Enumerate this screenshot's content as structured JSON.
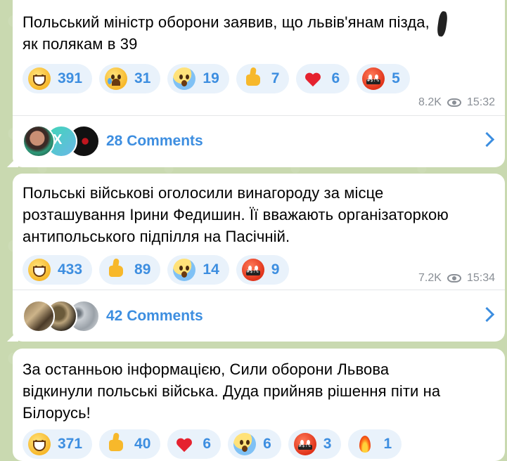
{
  "messages": [
    {
      "text": "Польський міністр оборони заявив, що львів'янам пізда,\nяк полякам в 39",
      "reactions": [
        {
          "emoji": "grinning-face",
          "count": "391"
        },
        {
          "emoji": "crying-face",
          "count": "31"
        },
        {
          "emoji": "screaming-face",
          "count": "19"
        },
        {
          "emoji": "thumbs-up",
          "count": "7"
        },
        {
          "emoji": "red-heart",
          "count": "6"
        },
        {
          "emoji": "cursing-face",
          "count": "5"
        }
      ],
      "views": "8.2K",
      "time": "15:32",
      "comments_label": "28 Comments"
    },
    {
      "text": "Польські військові оголосили винагороду за місце\nрозташування Ірини Федишин. Її вважають організаторкою\nантипольського підпілля на Пасічній.",
      "reactions": [
        {
          "emoji": "grinning-face",
          "count": "433"
        },
        {
          "emoji": "thumbs-up",
          "count": "89"
        },
        {
          "emoji": "screaming-face",
          "count": "14"
        },
        {
          "emoji": "cursing-face",
          "count": "9"
        }
      ],
      "views": "7.2K",
      "time": "15:34",
      "comments_label": "42 Comments"
    },
    {
      "text": "За останньою інформацією, Сили оборони Львова\nвідкинули польські війська. Дуда прийняв рішення піти на\nБілорусь!",
      "reactions": [
        {
          "emoji": "grinning-face",
          "count": "371"
        },
        {
          "emoji": "thumbs-up",
          "count": "40"
        },
        {
          "emoji": "red-heart",
          "count": "6"
        },
        {
          "emoji": "screaming-face",
          "count": "6"
        },
        {
          "emoji": "cursing-face",
          "count": "3"
        },
        {
          "emoji": "fire",
          "count": "1"
        }
      ]
    }
  ],
  "colors": {
    "accent": "#3d8ee0",
    "reaction_bg": "#e9f2fb",
    "meta": "#8a8f96",
    "wallpaper": "#c9d9b0"
  }
}
